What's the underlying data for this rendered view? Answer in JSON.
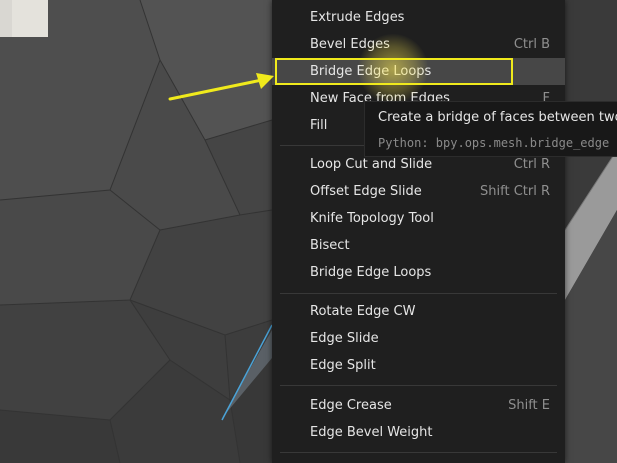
{
  "menu": {
    "items": [
      {
        "label": "Extrude Edges",
        "shortcut": ""
      },
      {
        "label": "Bevel Edges",
        "shortcut": "Ctrl B"
      },
      {
        "label": "Bridge Edge Loops",
        "shortcut": ""
      },
      {
        "label": "New Face from Edges",
        "shortcut": "F"
      },
      {
        "label": "Fill",
        "shortcut": ""
      },
      {
        "label": "Loop Cut and Slide",
        "shortcut": "Ctrl R"
      },
      {
        "label": "Offset Edge Slide",
        "shortcut": "Shift Ctrl R"
      },
      {
        "label": "Knife Topology Tool",
        "shortcut": ""
      },
      {
        "label": "Bisect",
        "shortcut": ""
      },
      {
        "label": "Bridge Edge Loops",
        "shortcut": ""
      },
      {
        "label": "Rotate Edge CW",
        "shortcut": ""
      },
      {
        "label": "Edge Slide",
        "shortcut": ""
      },
      {
        "label": "Edge Split",
        "shortcut": ""
      },
      {
        "label": "Edge Crease",
        "shortcut": "Shift E"
      },
      {
        "label": "Edge Bevel Weight",
        "shortcut": ""
      }
    ]
  },
  "tooltip": {
    "description": "Create a bridge of faces between two",
    "python": "Python: bpy.ops.mesh.bridge_edge"
  },
  "colors": {
    "annotation": "#f0ea1c",
    "menu_bg": "#1f1f1f",
    "highlight_bg": "#474747"
  }
}
